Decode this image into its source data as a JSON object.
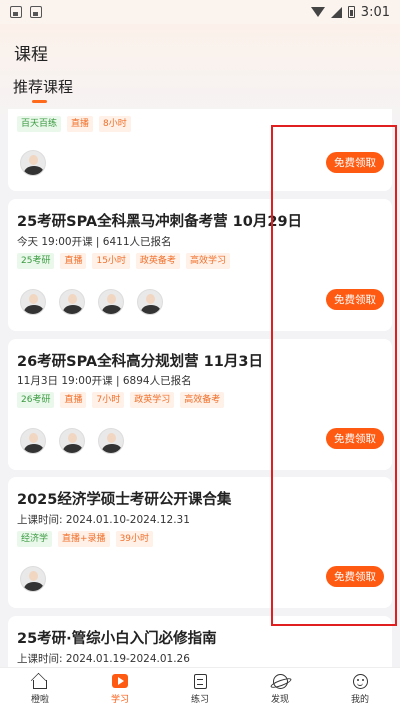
{
  "status_bar": {
    "time": "3:01"
  },
  "header": {
    "title": "课程",
    "section_title": "推荐课程"
  },
  "cards": [
    {
      "title": "",
      "subtitle": "",
      "tags": [
        {
          "label": "百天百练",
          "color": "green"
        },
        {
          "label": "直播",
          "color": "orange"
        },
        {
          "label": "8小时",
          "color": "orange"
        }
      ],
      "avatar_count": 1,
      "button_label": "免费领取"
    },
    {
      "title": "25考研SPA全科黑马冲刺备考营 10月29日",
      "subtitle": "今天 19:00开课 | 6411人已报名",
      "tags": [
        {
          "label": "25考研",
          "color": "green"
        },
        {
          "label": "直播",
          "color": "orange"
        },
        {
          "label": "15小时",
          "color": "orange"
        },
        {
          "label": "政英备考",
          "color": "orange"
        },
        {
          "label": "高效学习",
          "color": "orange"
        }
      ],
      "avatar_count": 4,
      "button_label": "免费领取"
    },
    {
      "title": "26考研SPA全科高分规划营  11月3日",
      "subtitle": "11月3日 19:00开课 | 6894人已报名",
      "tags": [
        {
          "label": "26考研",
          "color": "green"
        },
        {
          "label": "直播",
          "color": "orange"
        },
        {
          "label": "7小时",
          "color": "orange"
        },
        {
          "label": "政英学习",
          "color": "orange"
        },
        {
          "label": "高效备考",
          "color": "orange"
        }
      ],
      "avatar_count": 3,
      "button_label": "免费领取"
    },
    {
      "title": "2025经济学硕士考研公开课合集",
      "subtitle": "上课时间:   2024.01.10-2024.12.31",
      "tags": [
        {
          "label": "经济学",
          "color": "green"
        },
        {
          "label": "直播+录播",
          "color": "orange"
        },
        {
          "label": "39小时",
          "color": "orange"
        }
      ],
      "avatar_count": 1,
      "button_label": "免费领取"
    },
    {
      "title": "25考研·管综小白入门必修指南",
      "subtitle": "上课时间:   2024.01.19-2024.01.26",
      "tags": [],
      "avatar_count": 0,
      "button_label": ""
    }
  ],
  "bottom_nav": [
    {
      "label": "橙啦",
      "icon": "home-icon",
      "active": false
    },
    {
      "label": "学习",
      "icon": "study-icon",
      "active": true
    },
    {
      "label": "练习",
      "icon": "practice-icon",
      "active": false
    },
    {
      "label": "发现",
      "icon": "discover-icon",
      "active": false
    },
    {
      "label": "我的",
      "icon": "mine-icon",
      "active": false
    }
  ],
  "colors": {
    "accent": "#ff5a12",
    "tag_green": "#3a9a3f",
    "tag_orange": "#f0702a",
    "highlight": "#e02020"
  }
}
